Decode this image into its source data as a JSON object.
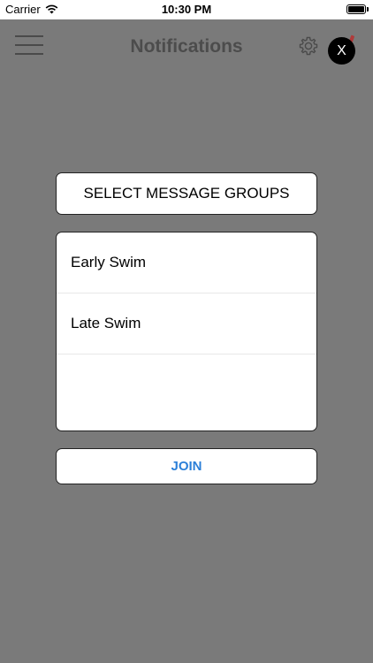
{
  "status_bar": {
    "carrier": "Carrier",
    "time": "10:30 PM",
    "wifi_icon": "wifi-icon",
    "battery_icon": "battery-icon"
  },
  "nav": {
    "title": "Notifications",
    "menu_icon": "hamburger-menu-icon",
    "settings_icon": "gear-icon"
  },
  "modal": {
    "close_label": "X",
    "header": "SELECT MESSAGE GROUPS",
    "groups": [
      {
        "label": "Early Swim"
      },
      {
        "label": "Late Swim"
      }
    ],
    "join_label": "JOIN"
  },
  "colors": {
    "overlay": "#7a7a7a",
    "accent": "#2b7fd8",
    "close_button": "#000000"
  }
}
